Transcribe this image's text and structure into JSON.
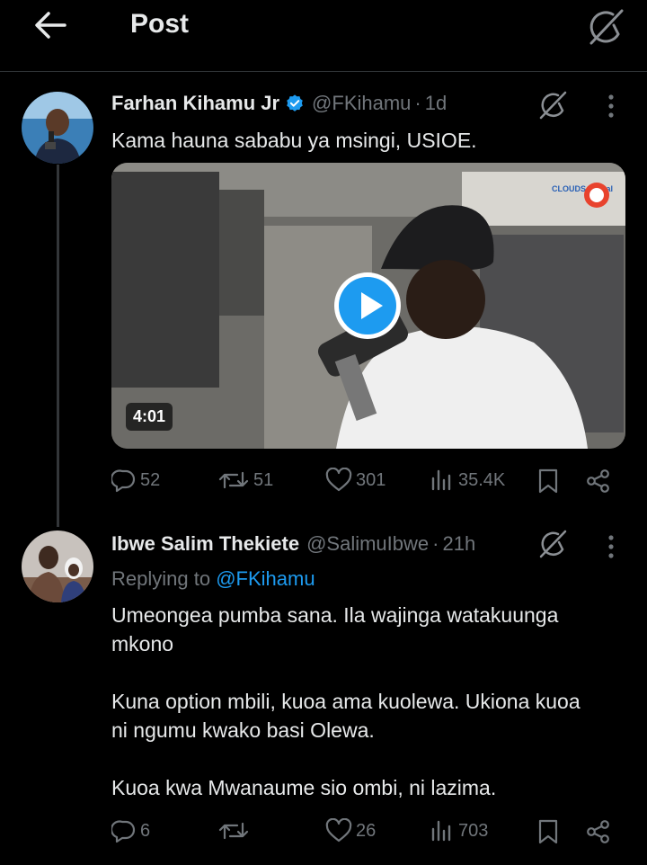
{
  "header": {
    "title": "Post"
  },
  "tweet": {
    "name": "Farhan Kihamu Jr",
    "handle": "@FKihamu",
    "time": "1d",
    "text": "Kama hauna sababu ya msingi, USIOE.",
    "video_duration": "4:01",
    "video_watermark": "CLOUDS Digital",
    "stats": {
      "replies": "52",
      "reposts": "51",
      "likes": "301",
      "views": "35.4K"
    }
  },
  "reply": {
    "name": "Ibwe Salim Thekiete",
    "handle": "@SalimuIbwe",
    "time": "21h",
    "replying_prefix": "Replying to",
    "replying_to": "@FKihamu",
    "paragraph1_line1": "Umeongea pumba sana. Ila wajinga watakuunga",
    "paragraph1_line2": "mkono",
    "paragraph2_line1": "Kuna option mbili, kuoa ama kuolewa. Ukiona kuoa",
    "paragraph2_line2": "ni ngumu kwako basi Olewa.",
    "paragraph3": "Kuoa kwa Mwanaume sio ombi, ni lazima.",
    "stats": {
      "replies": "6",
      "reposts": "",
      "likes": "26",
      "views": "703"
    }
  },
  "colors": {
    "background": "#000000",
    "text_primary": "#e7e9ea",
    "text_secondary": "#71767b",
    "accent": "#1d9bf0",
    "divider": "#2f3336"
  },
  "icons": [
    "back-arrow-icon",
    "grok-icon",
    "verified-badge-icon",
    "more-icon",
    "play-icon",
    "reply-icon",
    "repost-icon",
    "like-icon",
    "views-icon",
    "bookmark-icon",
    "share-icon"
  ]
}
